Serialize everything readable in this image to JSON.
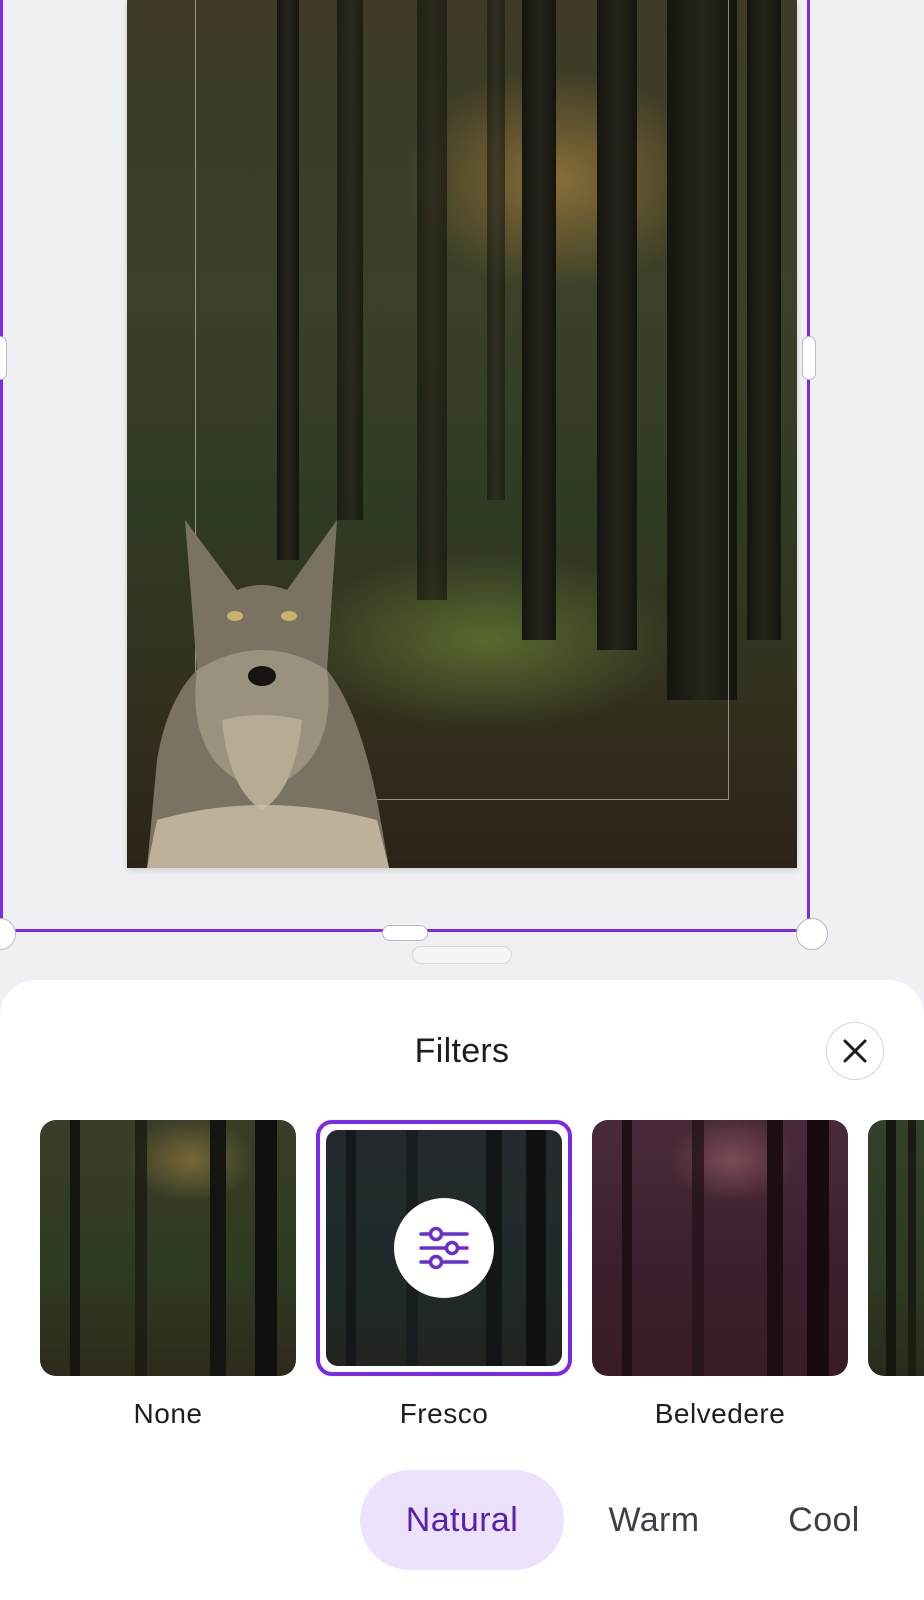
{
  "sheet": {
    "title": "Filters"
  },
  "filters": [
    {
      "label": "None",
      "selected": false,
      "tint": "#2f3a24"
    },
    {
      "label": "Fresco",
      "selected": true,
      "tint": "#1f2a30"
    },
    {
      "label": "Belvedere",
      "selected": false,
      "tint": "#3e1f2c"
    }
  ],
  "tone_tabs": [
    {
      "label": "Natural",
      "active": true
    },
    {
      "label": "Warm",
      "active": false
    },
    {
      "label": "Cool",
      "active": false
    }
  ],
  "icons": {
    "close": "close-icon",
    "adjust": "sliders-icon"
  },
  "colors": {
    "accent": "#7d2ae8",
    "active_tab_bg": "#ece2fb",
    "active_tab_text": "#5a1fb0"
  }
}
